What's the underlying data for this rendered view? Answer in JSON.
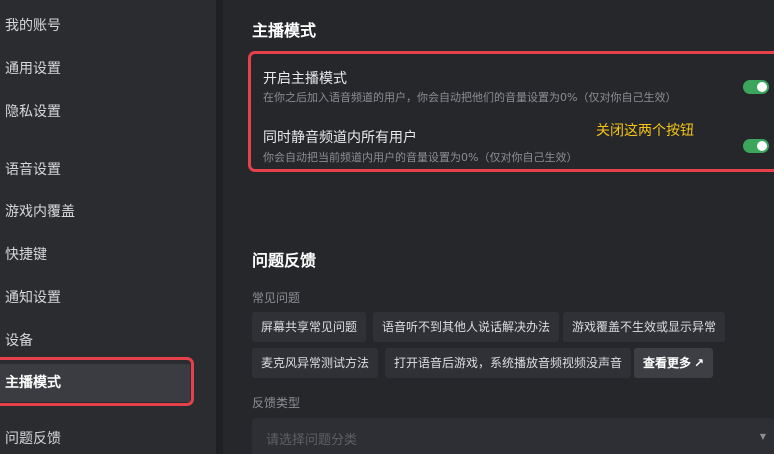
{
  "sidebar": {
    "items": [
      {
        "label": "我的账号"
      },
      {
        "label": "通用设置"
      },
      {
        "label": "隐私设置"
      },
      {
        "label": "语音设置"
      },
      {
        "label": "游戏内覆盖"
      },
      {
        "label": "快捷键"
      },
      {
        "label": "通知设置"
      },
      {
        "label": "设备"
      },
      {
        "label": "主播模式"
      },
      {
        "label": "问题反馈"
      }
    ]
  },
  "streamer": {
    "title": "主播模式",
    "enable": {
      "label": "开启主播模式",
      "desc": "在你之后加入语音频道的用户，你会自动把他们的音量设置为0%（仅对你自己生效）",
      "on": true
    },
    "mute_all": {
      "label": "同时静音频道内所有用户",
      "desc": "你会自动把当前频道内用户的音量设置为0%（仅对你自己生效）",
      "on": true
    },
    "annotation": "关闭这两个按钮"
  },
  "feedback": {
    "title": "问题反馈",
    "faq_label": "常见问题",
    "faq_chips": [
      "屏幕共享常见问题",
      "语音听不到其他人说话解决办法",
      "游戏覆盖不生效或显示异常",
      "麦克风异常测试方法",
      "打开语音后游戏，系统播放音频视频没声音"
    ],
    "more_label": "查看更多",
    "more_icon": "↗",
    "type_label": "反馈类型",
    "type_placeholder": "请选择问题分类",
    "caret": "▼"
  },
  "colors": {
    "toggle_on": "#3ba55c",
    "annotation_box": "#e4414b",
    "annotation_text": "#f5c518"
  }
}
